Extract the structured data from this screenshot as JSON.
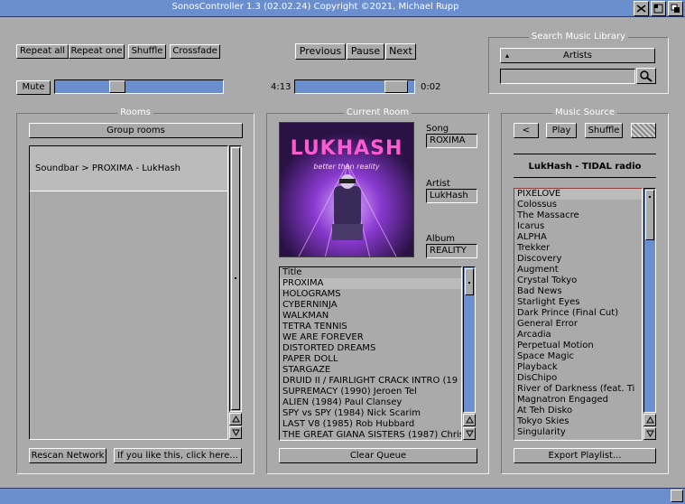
{
  "window": {
    "title": "SonosController 1.3 (02.02.24) Copyright ©2021, Michael Rupp"
  },
  "transport": {
    "repeat_all": "Repeat all",
    "repeat_one": "Repeat one",
    "shuffle": "Shuffle",
    "crossfade": "Crossfade",
    "previous": "Previous",
    "pause": "Pause",
    "next": "Next",
    "mute": "Mute",
    "elapsed": "4:13",
    "remaining": "0:02",
    "volume_level": 0.36,
    "progress_level": 0.93
  },
  "search": {
    "group_label": "Search Music Library",
    "category": "Artists",
    "query": ""
  },
  "rooms": {
    "group_label": "Rooms",
    "group_button": "Group rooms",
    "items": [
      "Soundbar > PROXIMA - LukHash"
    ],
    "rescan_button": "Rescan Network",
    "donate_button": "If you like this, click here..."
  },
  "current_room": {
    "group_label": "Current Room",
    "song_label": "Song",
    "song_value": "ROXIMA",
    "artist_label": "Artist",
    "artist_value": "LukHash",
    "album_label": "Album",
    "album_value": "REALITY",
    "album_art_text": "LUKHASH",
    "album_art_subtext": "better than reality",
    "queue_header": "Title",
    "queue": [
      "PROXIMA",
      "HOLOGRAMS",
      "CYBERNINJA",
      "WALKMAN",
      "TETRA TENNIS",
      "WE ARE FOREVER",
      "DISTORTED DREAMS",
      "PAPER DOLL",
      "STARGAZE",
      "DRUID II / FAIRLIGHT CRACK INTRO (19",
      "SUPREMACY (1990) Jeroen Tel",
      "ALIEN (1984) Paul Clansey",
      "SPY vs SPY (1984) Nick Scarim",
      "LAST V8 (1985) Rob Hubbard",
      "THE GREAT GIANA SISTERS (1987) Chris"
    ],
    "clear_queue_button": "Clear Queue"
  },
  "music_source": {
    "group_label": "Music Source",
    "back_button": "<",
    "play_button": "Play",
    "shuffle_button": "Shuffle",
    "source_title": "LukHash - TIDAL radio",
    "tracks": [
      "PIXELOVE",
      "Colossus",
      "The Massacre",
      "Icarus",
      "ALPHA",
      "Trekker",
      "Discovery",
      "Augment",
      "Crystal Tokyo",
      "Bad News",
      "Starlight Eyes",
      "Dark Prince (Final Cut)",
      "General Error",
      "Arcadia",
      "Perpetual Motion",
      "Space Magic",
      "Playback",
      "DisChipo",
      "River of Darkness (feat. Ti",
      "Magnatron Engaged",
      "At Teh Disko",
      "Tokyo Skies",
      "Singularity"
    ],
    "export_button": "Export Playlist..."
  }
}
